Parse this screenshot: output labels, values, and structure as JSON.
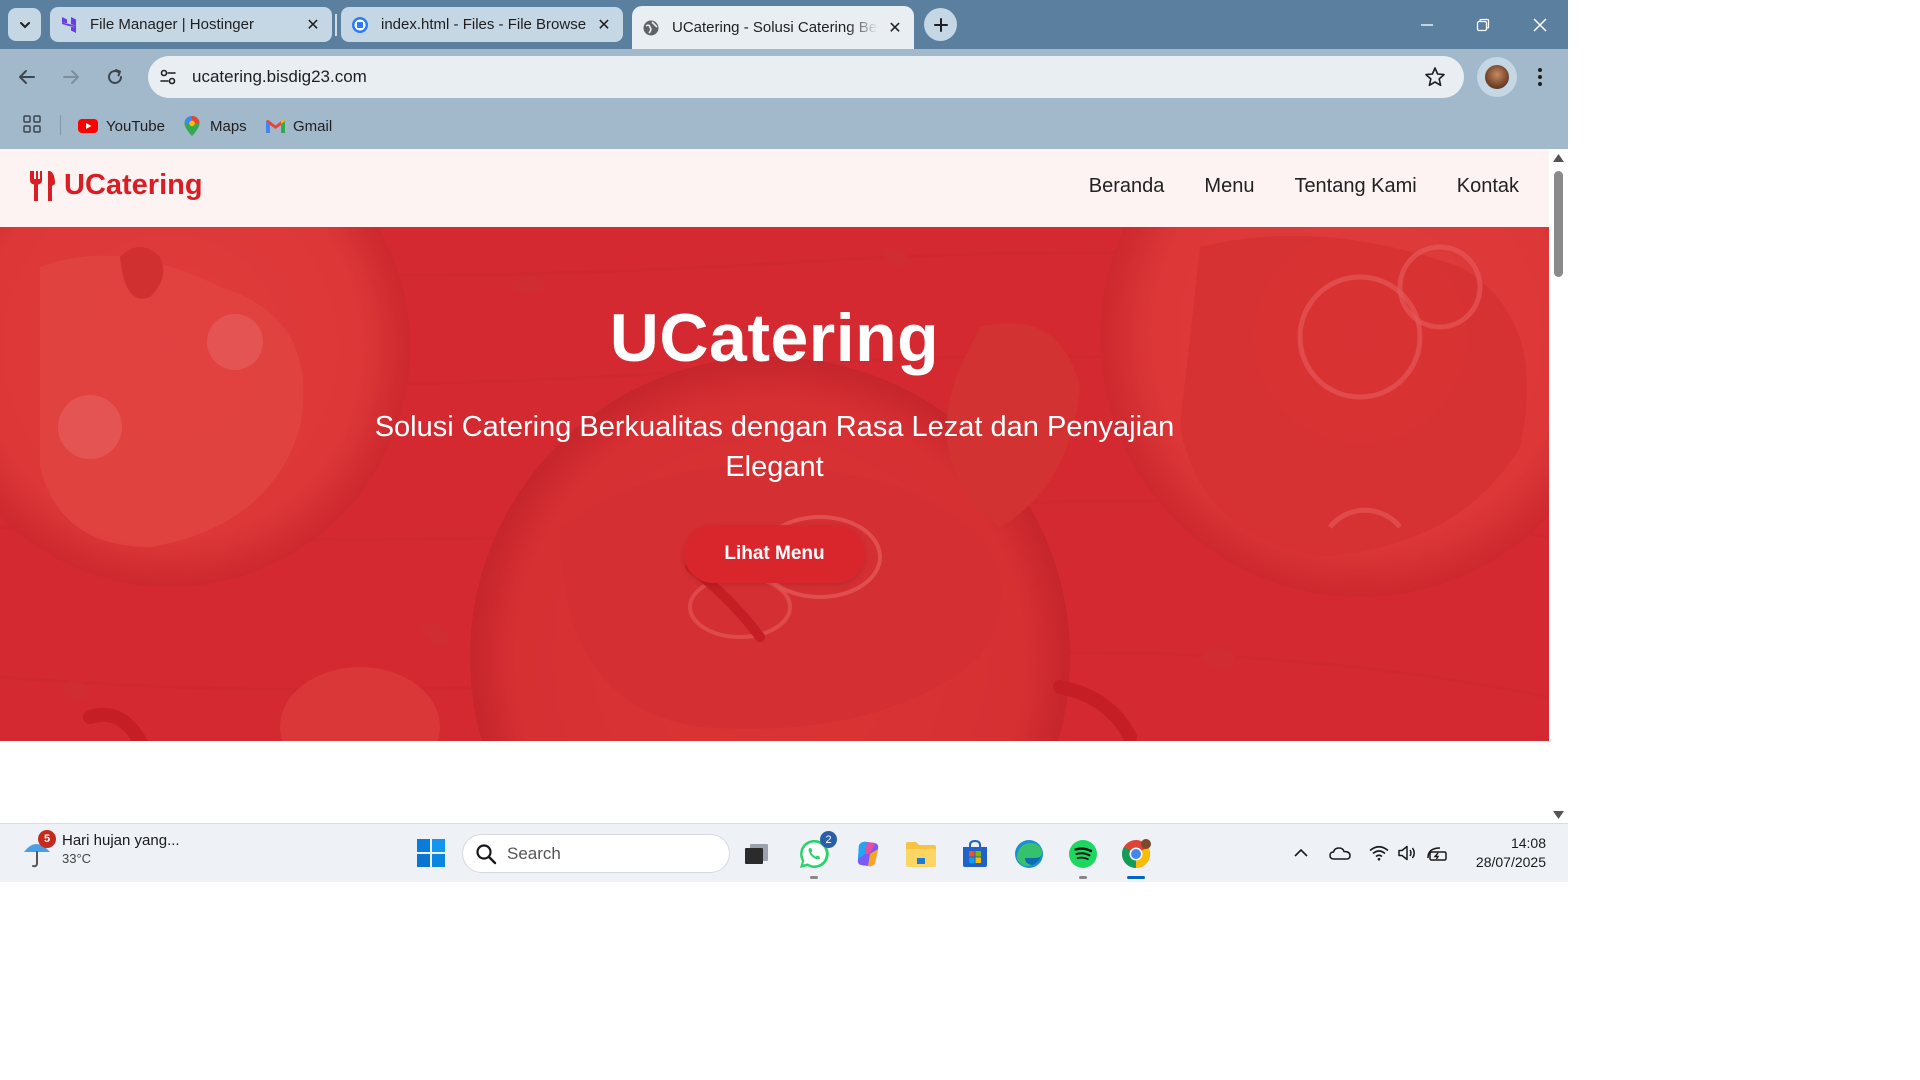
{
  "browser": {
    "tabs": [
      {
        "title": "File Manager | Hostinger",
        "active": false
      },
      {
        "title": "index.html - Files - File Browser",
        "active": false
      },
      {
        "title": "UCatering - Solusi Catering Berkualitas",
        "active": true
      }
    ],
    "url": "ucatering.bisdig23.com",
    "bookmarks": [
      {
        "label": "YouTube"
      },
      {
        "label": "Maps"
      },
      {
        "label": "Gmail"
      }
    ]
  },
  "site": {
    "brand": "UCatering",
    "nav": [
      "Beranda",
      "Menu",
      "Tentang Kami",
      "Kontak"
    ],
    "hero": {
      "title": "UCatering",
      "subtitle": "Solusi Catering Berkualitas dengan Rasa Lezat dan Penyajian Elegant",
      "cta": "Lihat Menu"
    },
    "accent_color": "#d81e24"
  },
  "taskbar": {
    "weather": {
      "text": "Hari hujan yang...",
      "temp": "33°C",
      "badge": "5"
    },
    "search_placeholder": "Search",
    "whatsapp_badge": "2",
    "time": "14:08",
    "date": "28/07/2025"
  }
}
